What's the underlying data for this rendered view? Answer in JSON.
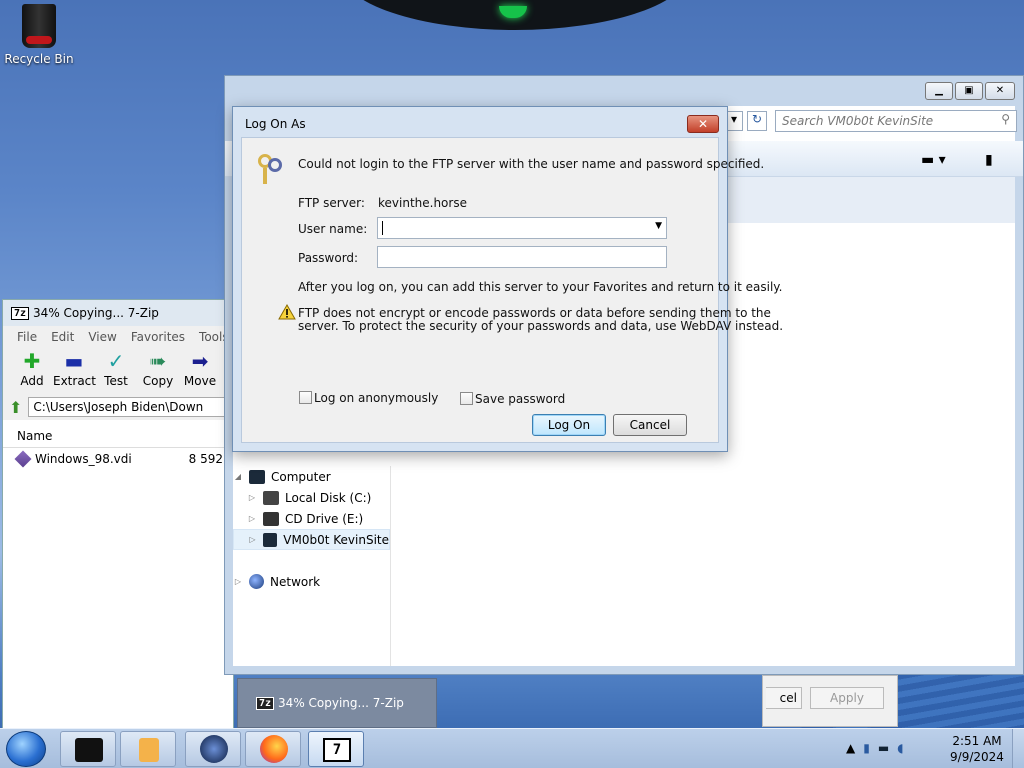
{
  "desktop": {
    "recycle_bin": "Recycle Bin"
  },
  "zip": {
    "title": "34% Copying... 7-Zip",
    "badge": "7z",
    "menu": [
      "File",
      "Edit",
      "View",
      "Favorites",
      "Tools"
    ],
    "tools": [
      {
        "label": "Add",
        "icon": "plus-icon",
        "color": "#22a82a"
      },
      {
        "label": "Extract",
        "icon": "minus-icon",
        "color": "#1b2fa8"
      },
      {
        "label": "Test",
        "icon": "check-icon",
        "color": "#20a0a0"
      },
      {
        "label": "Copy",
        "icon": "double-arrow-icon",
        "color": "#2a8a5a"
      },
      {
        "label": "Move",
        "icon": "arrow-icon",
        "color": "#1b1f8f"
      }
    ],
    "path": "C:\\Users\\Joseph Biden\\Down",
    "column_name": "Name",
    "file": {
      "name": "Windows_98.vdi",
      "size": "8 592"
    }
  },
  "explorer": {
    "search_placeholder": "Search VM0b0t KevinSite",
    "nav": {
      "computer": "Computer",
      "local_disk": "Local Disk (C:)",
      "cd_drive": "CD Drive (E:)",
      "site": "VM0b0t KevinSite",
      "network": "Network"
    },
    "cancel_partial": "cel",
    "apply": "Apply"
  },
  "dialog": {
    "title": "Log On As",
    "close": "✕",
    "message": "Could not login to the FTP server with the user name and password specified.",
    "server_label": "FTP server:",
    "server_value": "kevinthe.horse",
    "username_label": "User name:",
    "username_value": "",
    "password_label": "Password:",
    "password_value": "",
    "after_text": "After you log on, you can add this server to your Favorites and return to it easily.",
    "warn_line1": "FTP does not encrypt or encode passwords or data before sending them to the",
    "warn_line2": "server.  To protect the security of your passwords and data, use WebDAV instead.",
    "anon_label": "Log on anonymously",
    "save_label": "Save password",
    "logon_button": "Log On",
    "cancel_button": "Cancel"
  },
  "taskbar": {
    "popup_label": "34% Copying... 7-Zip",
    "popup_badge": "7z",
    "time": "2:51 AM",
    "date": "9/9/2024"
  }
}
